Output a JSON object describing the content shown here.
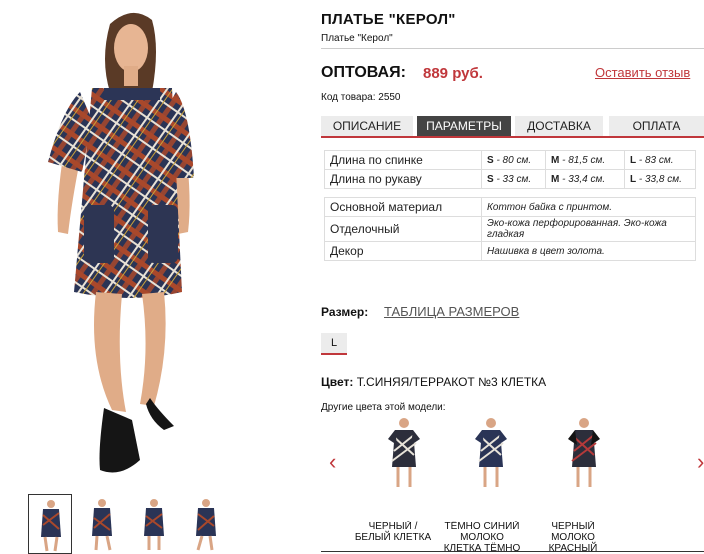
{
  "product": {
    "title": "ПЛАТЬЕ \"КЕРОЛ\"",
    "subtitle": "Платье \"Керол\"",
    "price_label": "ОПТОВАЯ:",
    "price_value": "889 руб.",
    "review_link": "Оставить отзыв",
    "code": "Код товара: 2550"
  },
  "tabs": [
    {
      "label": "ОПИСАНИЕ",
      "active": false
    },
    {
      "label": "ПАРАМЕТРЫ",
      "active": true
    },
    {
      "label": "ДОСТАВКА",
      "active": false
    },
    {
      "label": "ОПЛАТА",
      "active": false
    }
  ],
  "measurements": [
    {
      "label": "Длина по спинке",
      "s_key": "S",
      "s_val": " - 80 см.",
      "m_key": "M",
      "m_val": " - 81,5 см.",
      "l_key": "L",
      "l_val": " - 83 см."
    },
    {
      "label": "Длина по рукаву",
      "s_key": "S",
      "s_val": " - 33 см.",
      "m_key": "M",
      "m_val": " - 33,4 см.",
      "l_key": "L",
      "l_val": " - 33,8 см."
    }
  ],
  "properties": [
    {
      "label": "Основной материал",
      "value": "Коттон байка с принтом."
    },
    {
      "label": "Отделочный",
      "value": "Эко-кожа перфорированная. Эко-кожа гладкая"
    },
    {
      "label": "Декор",
      "value": "Нашивка в цвет золота."
    }
  ],
  "size": {
    "label": "Размер:",
    "table_link": "ТАБЛИЦА РАЗМЕРОВ",
    "options": [
      "L"
    ]
  },
  "color": {
    "label": "Цвет:",
    "value": "Т.СИНЯЯ/ТЕРРАКОТ №3 КЛЕТКА",
    "other_label": "Другие цвета этой модели:"
  },
  "other_models": [
    {
      "caption": "ЧЕРНЫЙ / БЕЛЫЙ КЛЕТКА"
    },
    {
      "caption": "ТЁМНО СИНИЙ МОЛОКО КЛЕТКА ТЁМНО"
    },
    {
      "caption": "ЧЕРНЫЙ МОЛОКО КРАСНЫЙ"
    }
  ],
  "colors": {
    "accent": "#c0373b",
    "tab_active": "#444444",
    "tab_bg": "#ececec"
  }
}
